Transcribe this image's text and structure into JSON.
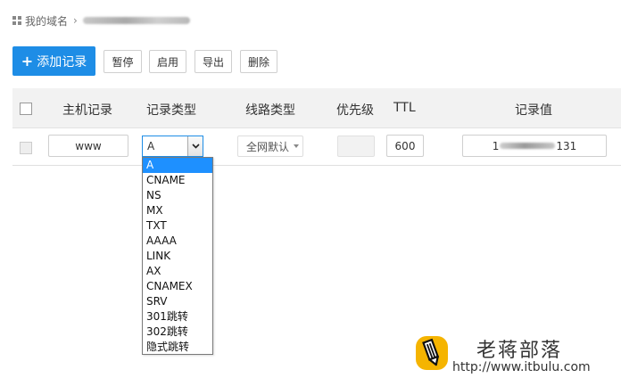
{
  "breadcrumb": {
    "root": "我的域名"
  },
  "toolbar": {
    "add": "添加记录",
    "pause": "暂停",
    "enable": "启用",
    "export": "导出",
    "delete": "删除"
  },
  "table": {
    "headers": {
      "host": "主机记录",
      "type": "记录类型",
      "line": "线路类型",
      "priority": "优先级",
      "ttl": "TTL",
      "value": "记录值"
    },
    "row": {
      "host": "www",
      "type": "A",
      "line": "全网默认",
      "priority": "",
      "ttl": "600",
      "value_start": "1",
      "value_end": "131"
    }
  },
  "dropdown": {
    "selected": "A",
    "options": [
      "A",
      "CNAME",
      "NS",
      "MX",
      "TXT",
      "AAAA",
      "LINK",
      "AX",
      "CNAMEX",
      "SRV",
      "301跳转",
      "302跳转",
      "隐式跳转"
    ]
  },
  "watermark": {
    "title": "老蒋部落",
    "url": "http://www.itbulu.com"
  },
  "colors": {
    "primary": "#1e8de6",
    "option_highlight": "#1e90ff",
    "header_bg": "#f2f2f2",
    "logo_yellow": "#f5b400"
  }
}
